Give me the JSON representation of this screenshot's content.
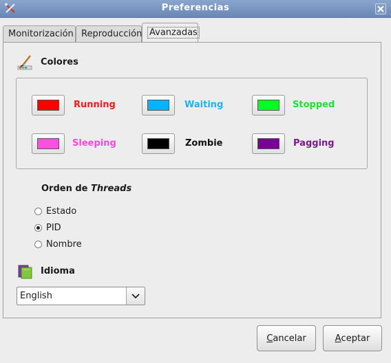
{
  "window": {
    "title": "Preferencias"
  },
  "tabs": [
    {
      "label": "Monitorización",
      "active": false
    },
    {
      "label": "Reproducción",
      "active": false
    },
    {
      "label": "Avanzadas",
      "active": true
    }
  ],
  "colors_section": {
    "title": "Colores",
    "icon": "paint-brush-icon",
    "items": [
      {
        "label": "Running",
        "color": "#ff0000"
      },
      {
        "label": "Waiting",
        "color": "#00b4ff"
      },
      {
        "label": "Stopped",
        "color": "#00ff22"
      },
      {
        "label": "Sleeping",
        "color": "#ff4fe0"
      },
      {
        "label": "Zombie",
        "color": "#000000"
      },
      {
        "label": "Pagging",
        "color": "#7a0099"
      }
    ],
    "label_colors": {
      "Running": "#ee1c1c",
      "Waiting": "#22b0ef",
      "Stopped": "#22dd33",
      "Sleeping": "#f04adc",
      "Zombie": "#111111",
      "Pagging": "#7a1a8a"
    }
  },
  "threads_order": {
    "title_prefix": "Orden de ",
    "title_emph": "Threads",
    "options": [
      {
        "label": "Estado",
        "checked": false
      },
      {
        "label": "PID",
        "checked": true
      },
      {
        "label": "Nombre",
        "checked": false
      }
    ]
  },
  "language": {
    "title": "Idioma",
    "icon": "language-book-icon",
    "selected": "English"
  },
  "buttons": {
    "cancel_first": "C",
    "cancel_rest": "ancelar",
    "accept_first": "A",
    "accept_rest": "ceptar"
  }
}
